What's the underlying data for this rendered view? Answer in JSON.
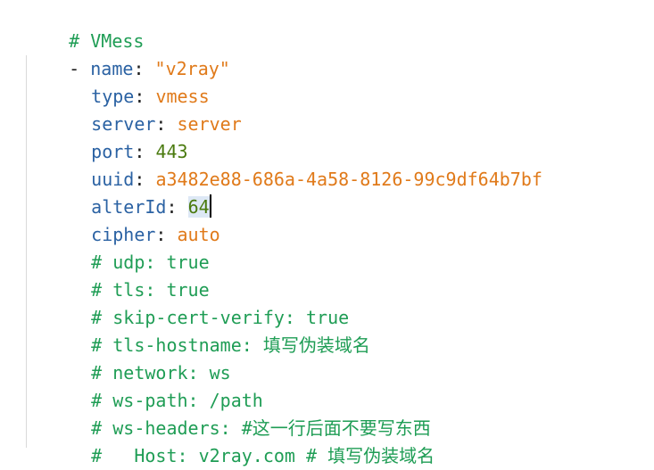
{
  "editor": {
    "lines": [
      {
        "comment": "# VMess"
      },
      {
        "dash": "- ",
        "key": "name",
        "sep": ": ",
        "value": "\"v2ray\""
      },
      {
        "key": "type",
        "sep": ": ",
        "value": "vmess"
      },
      {
        "key": "server",
        "sep": ": ",
        "value": "server"
      },
      {
        "key": "port",
        "sep": ": ",
        "value": "443"
      },
      {
        "key": "uuid",
        "sep": ": ",
        "value": "a3482e88-686a-4a58-8126-99c9df64b7bf"
      },
      {
        "key": "alterId",
        "sep": ": ",
        "value": "64"
      },
      {
        "key": "cipher",
        "sep": ": ",
        "value": "auto"
      },
      {
        "comment": "# udp: true"
      },
      {
        "comment": "# tls: true"
      },
      {
        "comment": "# skip-cert-verify: true"
      },
      {
        "comment": "# tls-hostname: 填写伪装域名"
      },
      {
        "comment": "# network: ws"
      },
      {
        "comment": "# ws-path: /path"
      },
      {
        "comment": "# ws-headers: #这一行后面不要写东西"
      },
      {
        "comment": "#   Host: v2ray.com # 填写伪装域名"
      }
    ]
  },
  "colors": {
    "comment": "#1f9d55",
    "key": "#2b62a3",
    "string": "#e07a1a",
    "number": "#4a7a0e",
    "selection": "#dde8f5"
  }
}
